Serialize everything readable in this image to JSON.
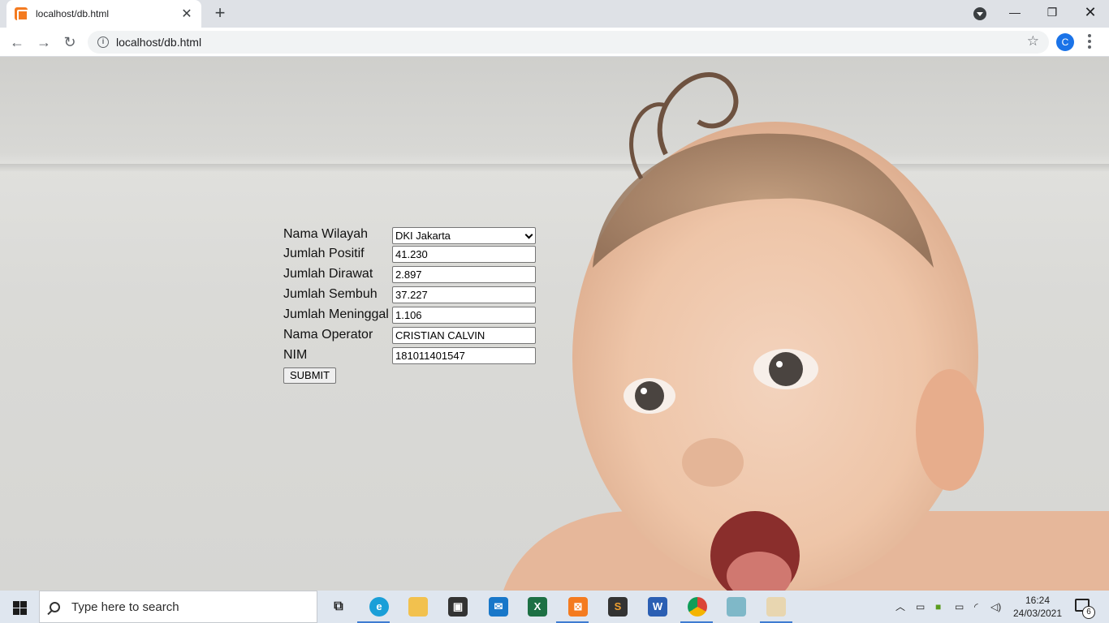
{
  "browser": {
    "tab_title": "localhost/db.html",
    "url": "localhost/db.html",
    "avatar_letter": "C"
  },
  "form": {
    "labels": {
      "wilayah": "Nama Wilayah",
      "positif": "Jumlah Positif",
      "dirawat": "Jumlah Dirawat",
      "sembuh": "Jumlah Sembuh",
      "meninggal": "Jumlah Meninggal",
      "operator": "Nama Operator",
      "nim": "NIM"
    },
    "values": {
      "wilayah": "DKI Jakarta",
      "positif": "41.230",
      "dirawat": "2.897",
      "sembuh": "37.227",
      "meninggal": "1.106",
      "operator": "CRISTIAN CALVIN",
      "nim": "181011401547"
    },
    "submit_label": "SUBMIT"
  },
  "taskbar": {
    "search_placeholder": "Type here to search",
    "time": "16:24",
    "date": "24/03/2021",
    "notification_count": "6"
  }
}
